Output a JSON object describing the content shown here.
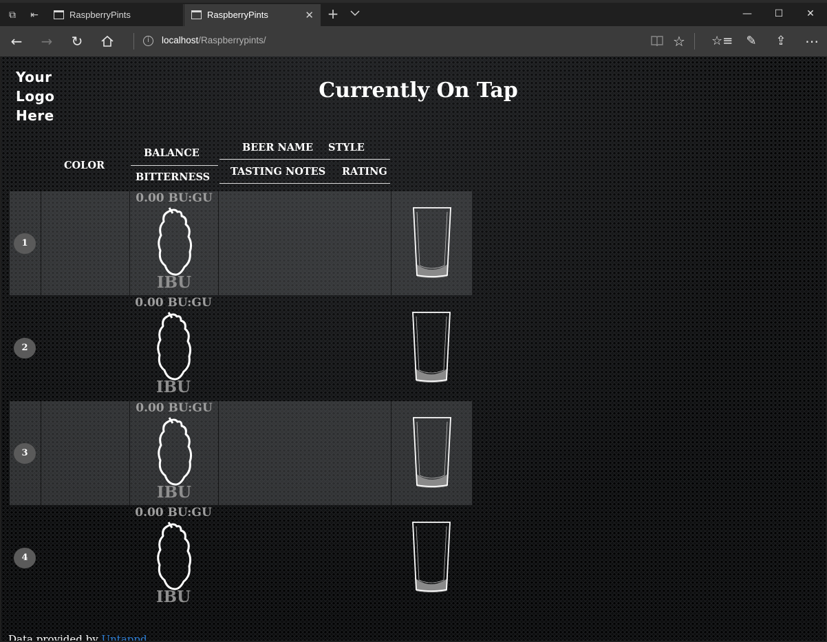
{
  "browser": {
    "tabs": [
      {
        "title": "RaspberryPints",
        "active": false
      },
      {
        "title": "RaspberryPints",
        "active": true
      }
    ],
    "url_host": "localhost",
    "url_path": "/Raspberrypints/"
  },
  "page": {
    "logo_lines": [
      "Your",
      "Logo",
      "Here"
    ],
    "title": "Currently On Tap",
    "headers": {
      "color": "COLOR",
      "balance": "BALANCE",
      "bitterness": "BITTERNESS",
      "beer_name": "BEER NAME",
      "style": "STYLE",
      "tasting_notes": "TASTING NOTES",
      "rating": "RATING"
    },
    "taps": [
      {
        "number": "1",
        "bugu": "0.00 BU:GU",
        "ibu_label": "IBU"
      },
      {
        "number": "2",
        "bugu": "0.00 BU:GU",
        "ibu_label": "IBU"
      },
      {
        "number": "3",
        "bugu": "0.00 BU:GU",
        "ibu_label": "IBU"
      },
      {
        "number": "4",
        "bugu": "0.00 BU:GU",
        "ibu_label": "IBU"
      }
    ],
    "footer_text": "Data provided by",
    "footer_link": "Untappd"
  }
}
